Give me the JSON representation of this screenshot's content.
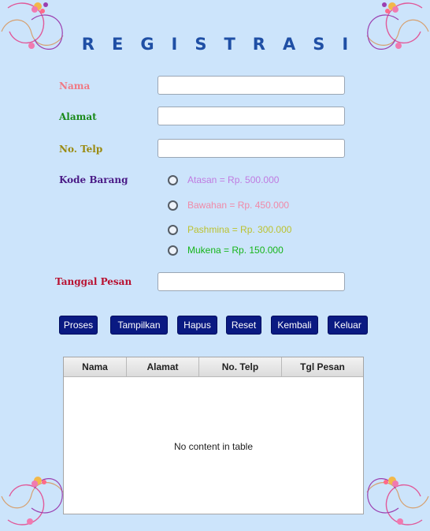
{
  "title": "REGISTRASI",
  "form": {
    "nama_label": "Nama",
    "alamat_label": "Alamat",
    "telp_label": "No. Telp",
    "kode_label": "Kode Barang",
    "tanggal_label": "Tanggal Pesan",
    "nama_value": "",
    "alamat_value": "",
    "telp_value": "",
    "tanggal_value": ""
  },
  "options": [
    {
      "label": "Atasan = Rp. 500.000",
      "color": "#c07be0"
    },
    {
      "label": "Bawahan = Rp. 450.000",
      "color": "#f08aa8"
    },
    {
      "label": "Pashmina = Rp. 300.000",
      "color": "#bcc230"
    },
    {
      "label": "Mukena = Rp. 150.000",
      "color": "#16b51a"
    }
  ],
  "buttons": {
    "proses": "Proses",
    "tampilkan": "Tampilkan",
    "hapus": "Hapus",
    "reset": "Reset",
    "kembali": "Kembali",
    "keluar": "Keluar"
  },
  "table": {
    "headers": [
      "Nama",
      "Alamat",
      "No. Telp",
      "Tgl Pesan"
    ],
    "empty_text": "No content in table"
  },
  "colors": {
    "background": "#cce4fb",
    "title": "#1f4fa5",
    "nama": "#f07a85",
    "alamat": "#1a8a1a",
    "telp": "#9a8a10",
    "kode": "#4a1a86",
    "tanggal": "#b81030",
    "button": "#0a1a82"
  },
  "decor": {
    "corner_icon": "flower-ornament-icon"
  }
}
